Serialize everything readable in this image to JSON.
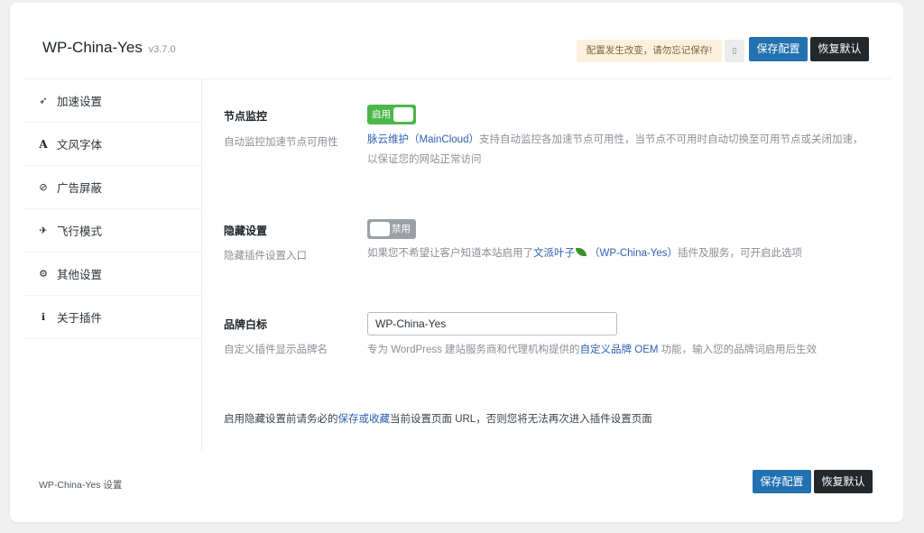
{
  "header": {
    "title": "WP-China-Yes",
    "version": "v3.7.0",
    "notice": "配置发生改变，请勿忘记保存!",
    "small_button_glyph": "▯",
    "save_label": "保存配置",
    "reset_label": "恢复默认"
  },
  "sidebar": {
    "items": [
      {
        "label": "加速设置",
        "icon": "rocket-icon"
      },
      {
        "label": "文风字体",
        "icon": "font-icon"
      },
      {
        "label": "广告屏蔽",
        "icon": "ban-icon"
      },
      {
        "label": "飞行模式",
        "icon": "plane-icon"
      },
      {
        "label": "其他设置",
        "icon": "gears-icon"
      },
      {
        "label": "关于插件",
        "icon": "info-icon"
      }
    ]
  },
  "fields": {
    "monitor": {
      "title": "节点监控",
      "subtitle": "自动监控加速节点可用性",
      "toggle_label": "启用",
      "toggle_on": true,
      "desc_link": "脉云维护（MainCloud）",
      "desc_text1": "支持自动监控各加速节点可用性，当节点不可用时自动切换至可用节点或关闭加速，",
      "desc_text2": "以保证您的网站正常访问"
    },
    "hide": {
      "title": "隐藏设置",
      "subtitle": "隐藏插件设置入口",
      "toggle_label": "禁用",
      "toggle_on": false,
      "desc_pre": "如果您不希望让客户知道本站启用了",
      "desc_link": "文派叶子",
      "desc_link2": "（WP-China-Yes）",
      "desc_post": "插件及服务，可开启此选项"
    },
    "brand": {
      "title": "品牌白标",
      "subtitle": "自定义插件显示品牌名",
      "value": "WP-China-Yes",
      "desc_pre": "专为 WordPress 建站服务商和代理机构提供的",
      "desc_link": "自定义品牌 OEM",
      "desc_post": "功能，输入您的品牌词启用后生效"
    },
    "note": {
      "pre": "启用隐藏设置前请务必的",
      "link": "保存或收藏",
      "post": "当前设置页面 URL，否则您将无法再次进入插件设置页面"
    }
  },
  "footer": {
    "label": "WP-China-Yes 设置",
    "save_label": "保存配置",
    "reset_label": "恢复默认"
  }
}
